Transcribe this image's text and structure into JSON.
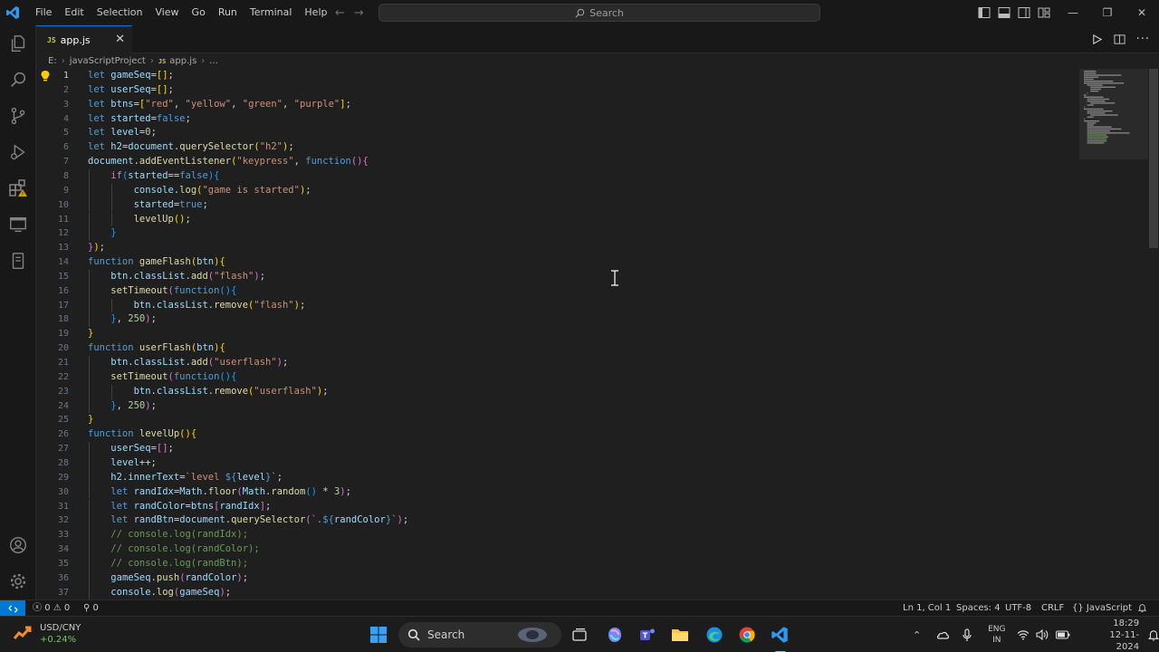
{
  "titlebar": {
    "menu": [
      "File",
      "Edit",
      "Selection",
      "View",
      "Go",
      "Run",
      "Terminal",
      "Help"
    ],
    "search_placeholder": "Search",
    "icons": [
      "vscode-logo-icon",
      "back-arrow-icon",
      "forward-arrow-icon",
      "toggle-primary-sidebar-icon",
      "toggle-panel-icon",
      "toggle-secondary-sidebar-icon",
      "customize-layout-icon"
    ]
  },
  "activity_bar": [
    "explorer-icon",
    "search-icon",
    "source-control-icon",
    "run-debug-icon",
    "extensions-icon",
    "remote-explorer-icon",
    "testing-icon",
    "accounts-icon",
    "manage-gear-icon"
  ],
  "tab": {
    "file_label": "app.js",
    "file_badge": "JS",
    "close_glyph": "✕"
  },
  "breadcrumb": {
    "drive": "E:",
    "folder": "javaScriptProject",
    "file": "app.js",
    "more": "..."
  },
  "editor": {
    "active_line": 1,
    "lines": [
      "let gameSeq=[];",
      "let userSeq=[];",
      "let btns=[\"red\", \"yellow\", \"green\", \"purple\"];",
      "let started=false;",
      "let level=0;",
      "let h2=document.querySelector(\"h2\");",
      "document.addEventListener(\"keypress\", function(){",
      "    if(started==false){",
      "        console.log(\"game is started\");",
      "        started=true;",
      "        levelUp();",
      "    }",
      "});",
      "function gameFlash(btn){",
      "    btn.classList.add(\"flash\");",
      "    setTimeout(function(){",
      "        btn.classList.remove(\"flash\");",
      "    }, 250);",
      "}",
      "function userFlash(btn){",
      "    btn.classList.add(\"userflash\");",
      "    setTimeout(function(){",
      "        btn.classList.remove(\"userflash\");",
      "    }, 250);",
      "}",
      "function levelUp(){",
      "    userSeq=[];",
      "    level++;",
      "    h2.innerText=`level ${level}`;",
      "    let randIdx=Math.floor(Math.random() * 3);",
      "    let randColor=btns[randIdx];",
      "    let randBtn=document.querySelector(`.${randColor}`);",
      "    // console.log(randIdx);",
      "    // console.log(randColor);",
      "    // console.log(randBtn);",
      "    gameSeq.push(randColor);",
      "    console.log(gameSeq);"
    ]
  },
  "statusbar": {
    "errors": "0",
    "warnings": "0",
    "ports": "0",
    "position": "Ln 1, Col 1",
    "spaces": "Spaces: 4",
    "encoding": "UTF-8",
    "eol": "CRLF",
    "language": "JavaScript"
  },
  "taskbar": {
    "widget_title": "USD/CNY",
    "widget_change": "+0.24%",
    "search_label": "Search",
    "lang_top": "ENG",
    "lang_bottom": "IN",
    "time": "18:29",
    "date": "12-11-2024"
  },
  "colors": {
    "accent": "#0078d4",
    "editor_bg": "#1f1f1f",
    "keyword": "#569cd6",
    "string": "#ce9178",
    "function": "#dcdcaa",
    "comment": "#6a9955"
  }
}
